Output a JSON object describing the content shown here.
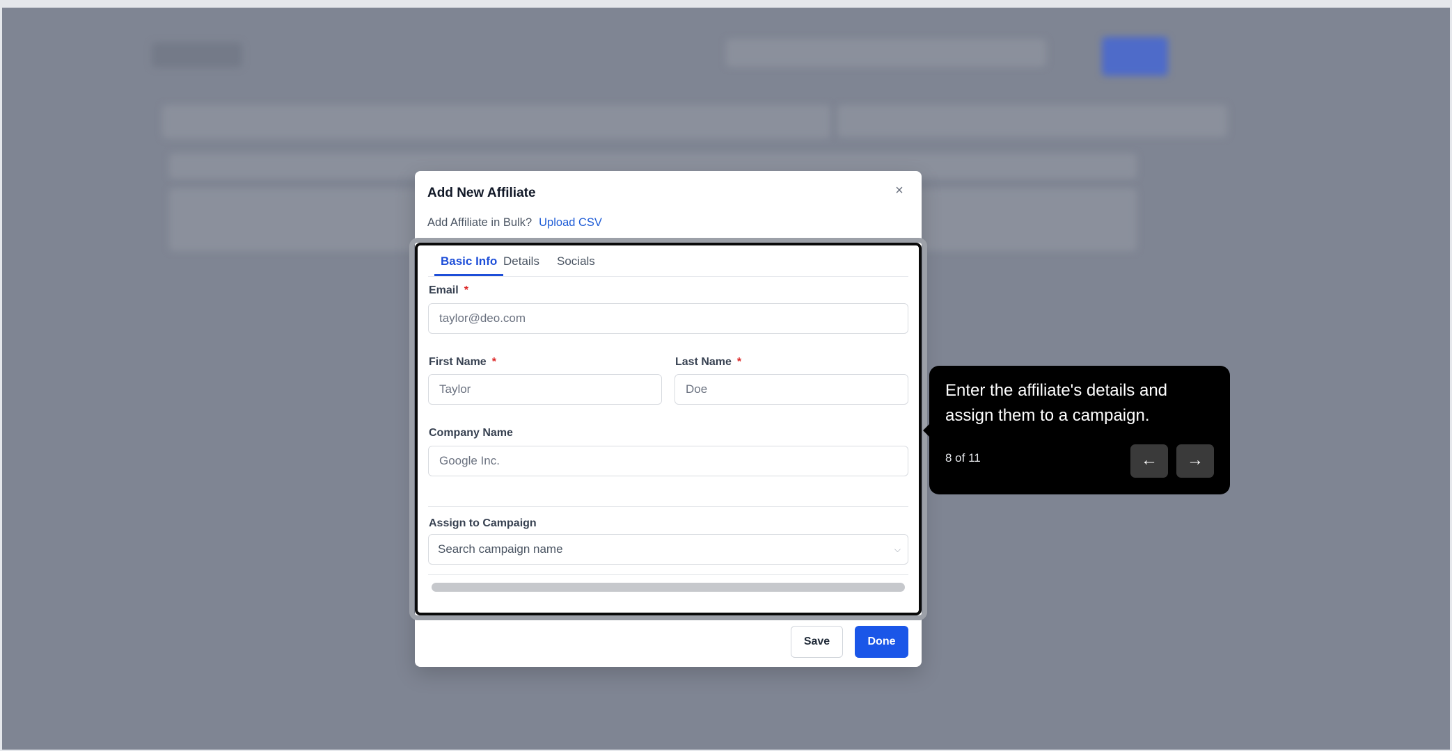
{
  "modal": {
    "title": "Add New Affiliate",
    "close_label": "×",
    "bulk_prompt": "Add Affiliate in Bulk?",
    "upload_link": "Upload CSV",
    "tabs": [
      {
        "label": "Basic Info",
        "active": true
      },
      {
        "label": "Details",
        "active": false
      },
      {
        "label": "Socials",
        "active": false
      }
    ],
    "email": {
      "label": "Email",
      "required_mark": "*",
      "placeholder": "taylor@deo.com"
    },
    "first_name": {
      "label": "First Name",
      "required_mark": "*",
      "placeholder": "Taylor"
    },
    "last_name": {
      "label": "Last Name",
      "required_mark": "*",
      "placeholder": "Doe"
    },
    "company": {
      "label": "Company Name",
      "placeholder": "Google Inc."
    },
    "campaign": {
      "label": "Assign to Campaign",
      "placeholder": "Search campaign name",
      "chevron": "chevron-down-icon"
    },
    "save_label": "Save",
    "done_label": "Done"
  },
  "tour": {
    "text": "Enter the affiliate's details and assign them to a campaign.",
    "step": "8 of 11",
    "prev_icon": "arrow-left-icon",
    "next_icon": "arrow-right-icon"
  },
  "colors": {
    "overlay": "#7f8593",
    "primary": "#1a56e8",
    "link": "#1d5bd6",
    "required": "#dc2626",
    "tooltip_bg": "#000000"
  }
}
